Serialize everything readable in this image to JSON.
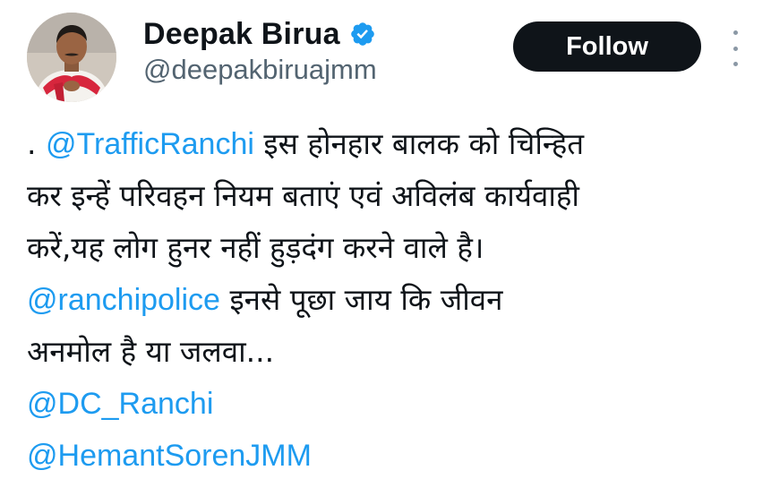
{
  "author": {
    "display_name": "Deepak Birua",
    "handle": "@deepakbiruajmm",
    "verified_icon": "verified-badge-icon",
    "avatar_icon": "avatar"
  },
  "actions": {
    "follow_label": "Follow",
    "more_icon": "more-vertical-icon"
  },
  "tweet": {
    "line1_prefix": ".",
    "line1_mention": "@TrafficRanchi",
    "line1_text": "इस होनहार बालक को चिन्हित",
    "line2_text": "कर इन्हें परिवहन नियम बताएं एवं अविलंब कार्यवाही",
    "line3_text": "करें,यह लोग हुनर नहीं हुड़दंग करने वाले है।",
    "line4_mention": "@ranchipolice",
    "line4_text": "इनसे पूछा जाय कि जीवन",
    "line5_text": "अनमोल है या जलवा...",
    "mention_dc": "@DC_Ranchi",
    "mention_hemant": "@HemantSorenJMM"
  },
  "colors": {
    "link": "#1d9bf0",
    "text": "#0f1419",
    "secondary": "#536471",
    "follow_bg": "#0f1419",
    "verified": "#1d9bf0"
  }
}
